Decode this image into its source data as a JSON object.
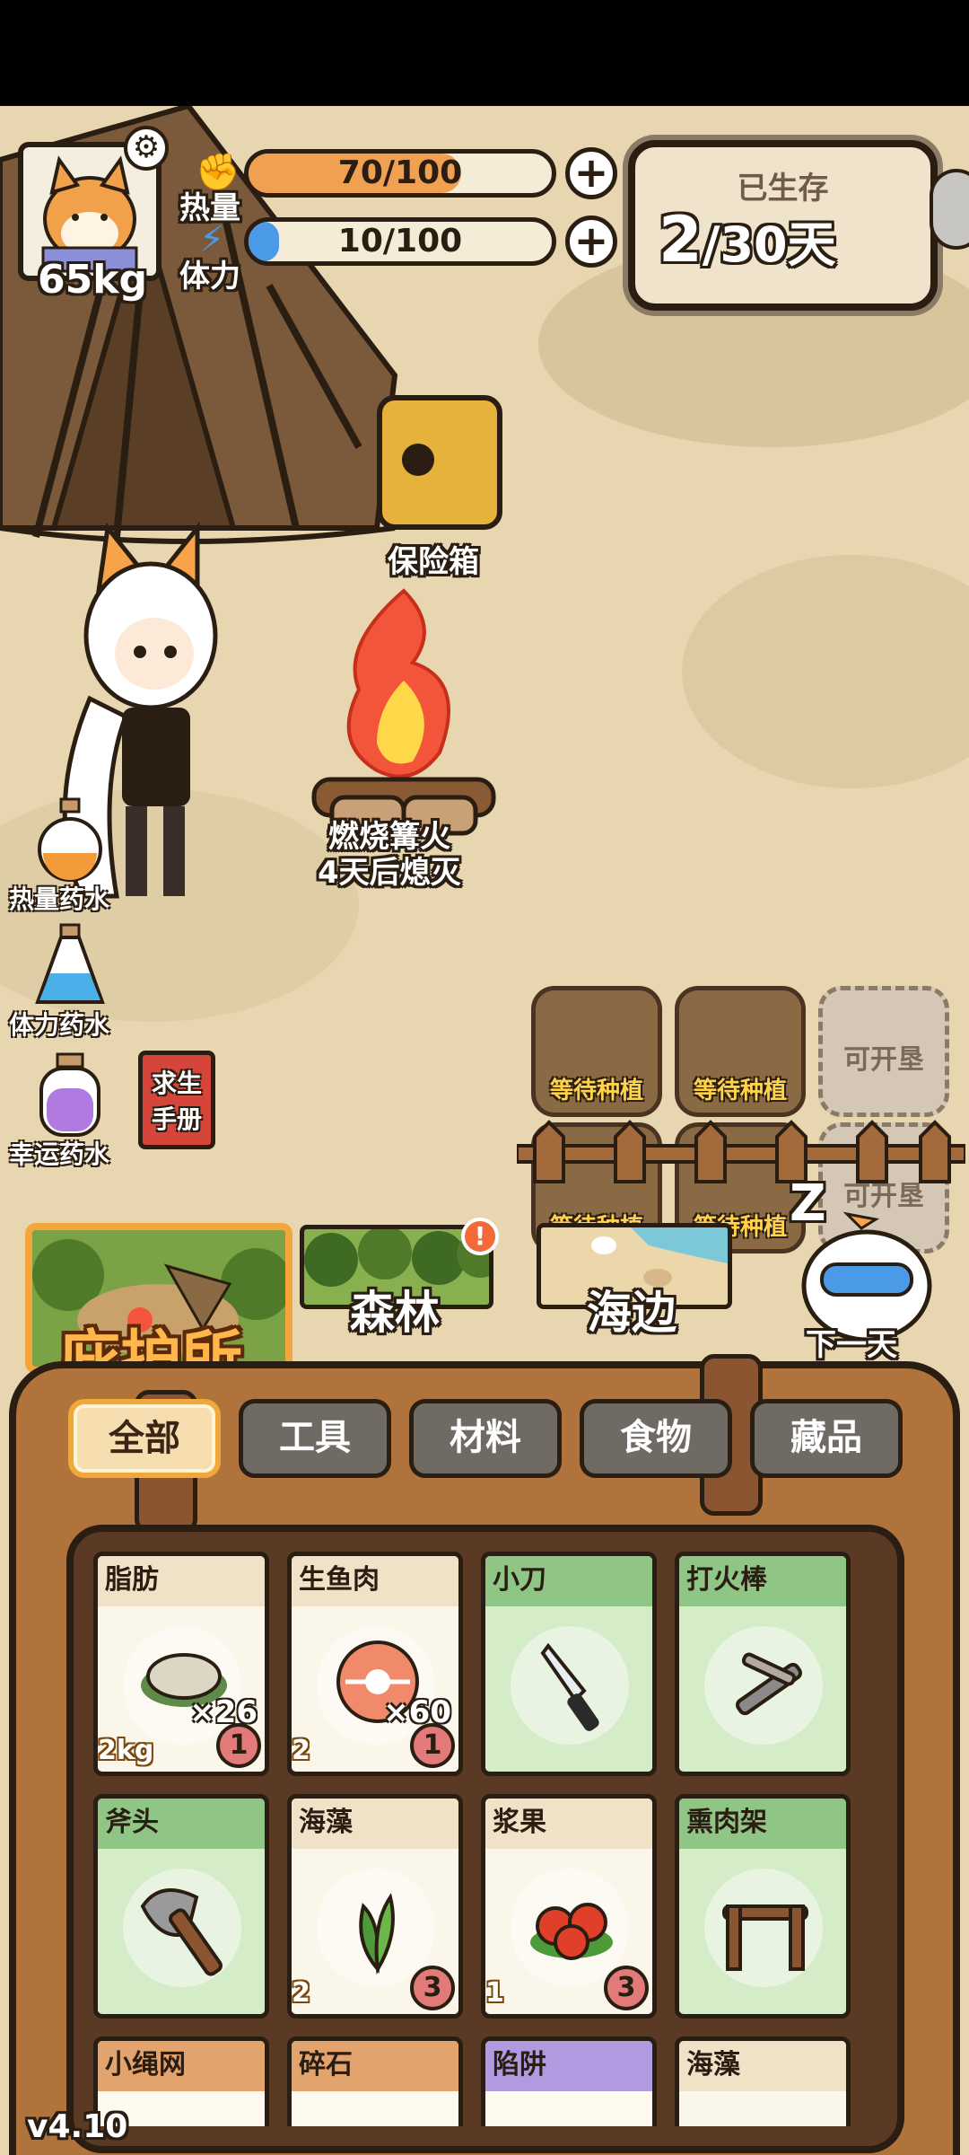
{
  "colors": {
    "ground": "#e7d6b0",
    "heat_bar": "#f0a050",
    "stamina_bar": "#4a9ae8",
    "accent_orange": "#ffb64a"
  },
  "player": {
    "weight": "65kg",
    "heat_label": "热量",
    "stamina_label": "体力",
    "heat_text": "70/100",
    "heat_ratio": 0.7,
    "stamina_text": "10/100",
    "stamina_ratio": 0.1
  },
  "survival": {
    "label": "已生存",
    "days_current": "2",
    "days_total": "/30天"
  },
  "scene": {
    "safe_label": "保险箱",
    "fire_label": "燃烧篝火",
    "fire_status": "4天后熄灭"
  },
  "potions": [
    {
      "label": "热量药水",
      "icon": "orange-potion-icon"
    },
    {
      "label": "体力药水",
      "icon": "blue-potion-icon"
    },
    {
      "label": "幸运药水",
      "icon": "purple-potion-icon"
    }
  ],
  "manual": {
    "line1": "求生",
    "line2": "手册"
  },
  "plots": [
    {
      "label": "等待种植",
      "locked": false
    },
    {
      "label": "等待种植",
      "locked": false
    },
    {
      "label": "可开垦",
      "locked": true
    },
    {
      "label": "等待种植",
      "locked": false
    },
    {
      "label": "等待种植",
      "locked": false
    },
    {
      "label": "可开垦",
      "locked": true
    }
  ],
  "locations": {
    "shelter": "庇护所",
    "forest": "森林",
    "forest_alert": "!",
    "beach": "海边",
    "next_day": "下一天",
    "sleep_zzz": "Z"
  },
  "tabs": [
    {
      "label": "全部",
      "active": true
    },
    {
      "label": "工具",
      "active": false
    },
    {
      "label": "材料",
      "active": false
    },
    {
      "label": "食物",
      "active": false
    },
    {
      "label": "藏品",
      "active": false
    }
  ],
  "inventory": [
    {
      "name": "脂肪",
      "theme": "cream",
      "qty": "×26",
      "weight": "2kg",
      "badge": "1",
      "icon": "fat-icon"
    },
    {
      "name": "生鱼肉",
      "theme": "cream",
      "qty": "×60",
      "weight": "2",
      "badge": "1",
      "icon": "raw-fish-icon"
    },
    {
      "name": "小刀",
      "theme": "green",
      "qty": "",
      "weight": "",
      "badge": "",
      "icon": "knife-icon"
    },
    {
      "name": "打火棒",
      "theme": "green",
      "qty": "",
      "weight": "",
      "badge": "",
      "icon": "fire-starter-icon"
    },
    {
      "name": "斧头",
      "theme": "green",
      "qty": "",
      "weight": "",
      "badge": "",
      "icon": "axe-icon"
    },
    {
      "name": "海藻",
      "theme": "cream",
      "qty": "",
      "weight": "2",
      "badge": "3",
      "icon": "seaweed-icon"
    },
    {
      "name": "浆果",
      "theme": "cream",
      "qty": "",
      "weight": "1",
      "badge": "3",
      "icon": "berry-icon"
    },
    {
      "name": "熏肉架",
      "theme": "green",
      "qty": "",
      "weight": "",
      "badge": "",
      "icon": "smoking-rack-icon"
    },
    {
      "name": "小绳网",
      "theme": "orange",
      "qty": "",
      "weight": "",
      "badge": "",
      "icon": ""
    },
    {
      "name": "碎石",
      "theme": "orange",
      "qty": "",
      "weight": "",
      "badge": "",
      "icon": ""
    },
    {
      "name": "陷阱",
      "theme": "purple",
      "qty": "",
      "weight": "",
      "badge": "",
      "icon": ""
    },
    {
      "name": "海藻",
      "theme": "cream",
      "qty": "",
      "weight": "",
      "badge": "",
      "icon": ""
    }
  ],
  "version": "v4.10"
}
